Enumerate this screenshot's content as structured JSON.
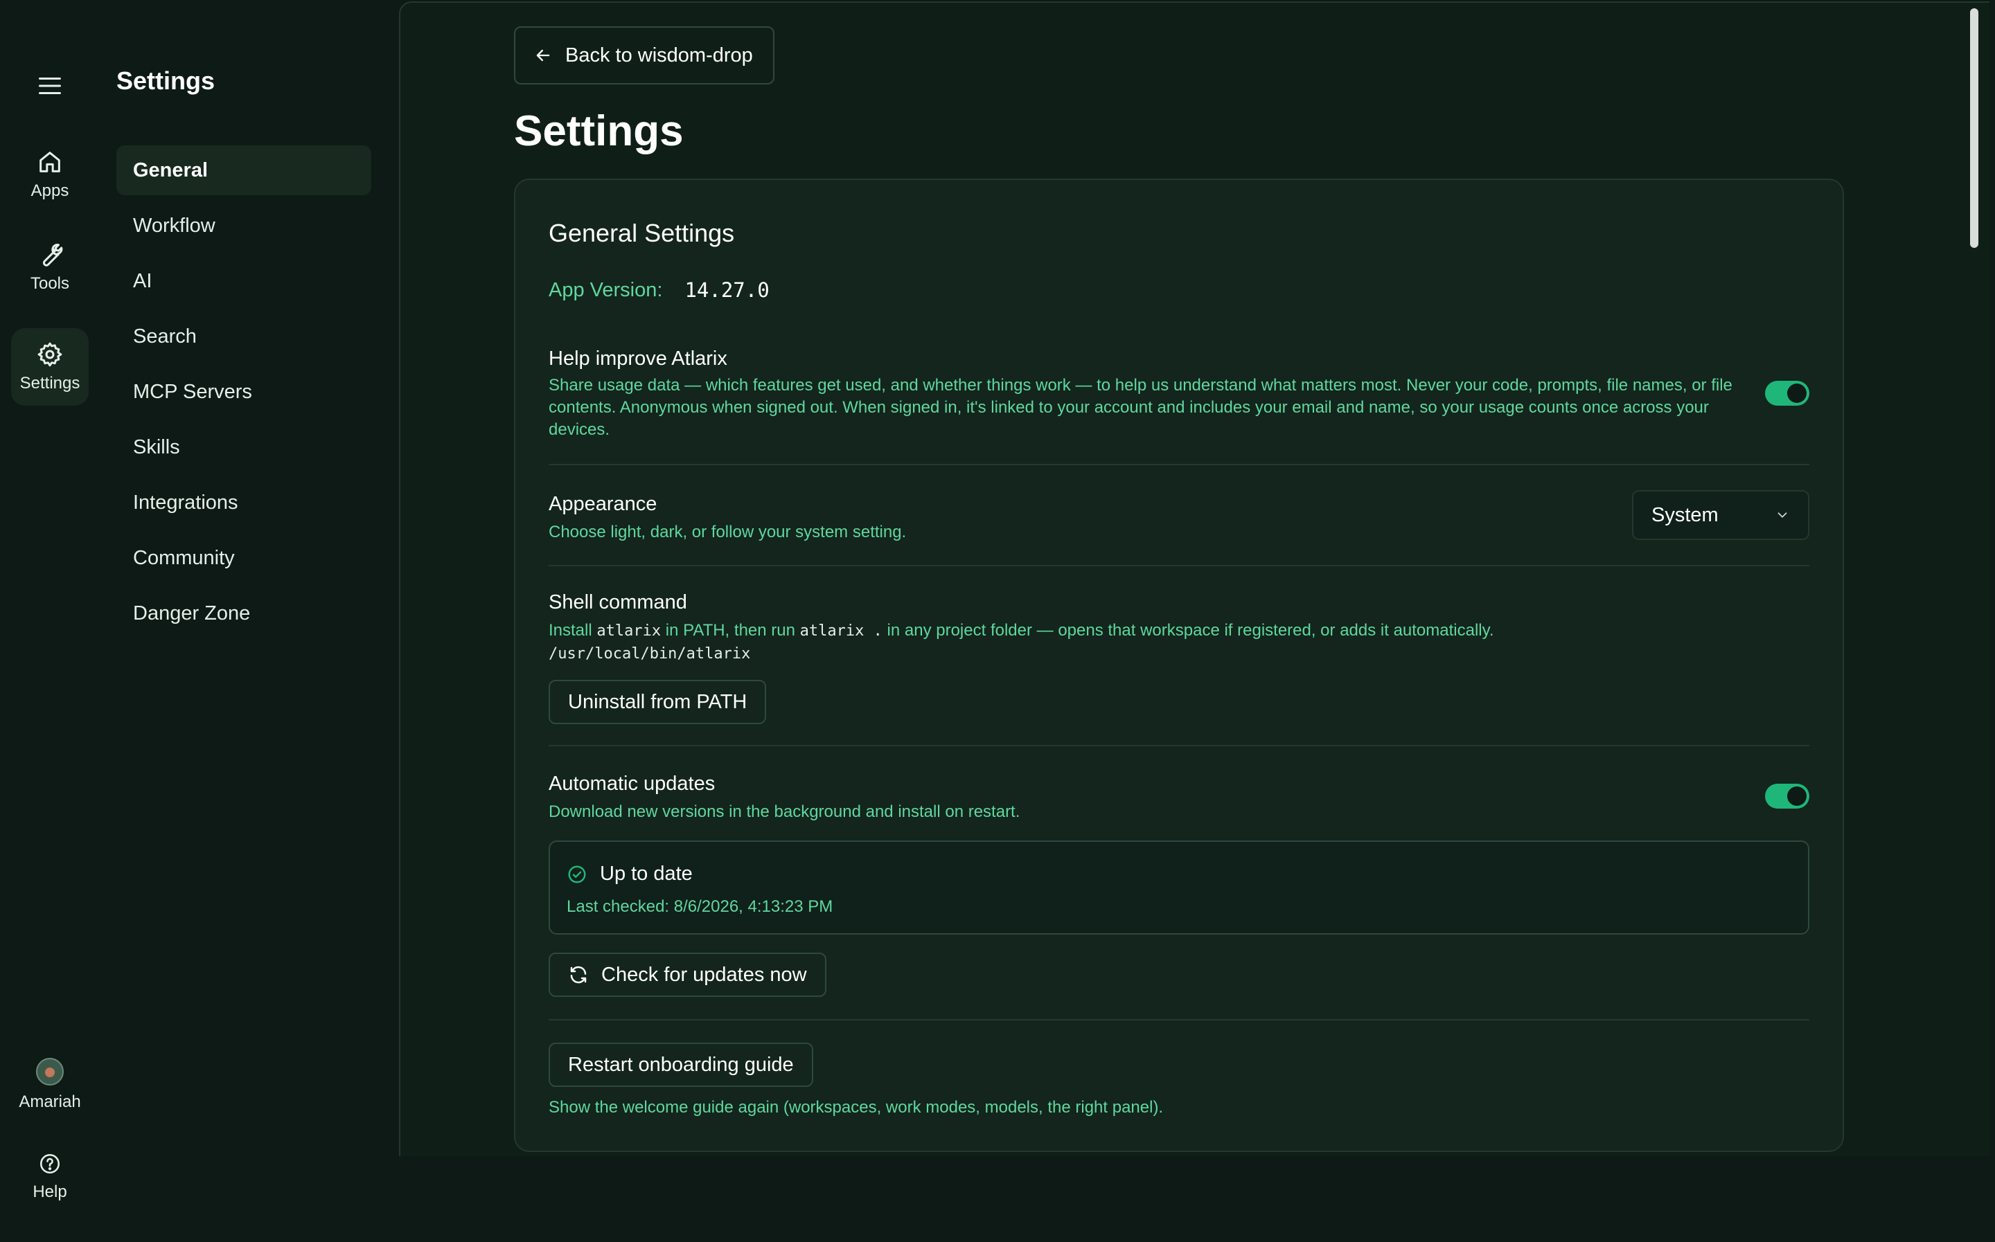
{
  "rail": {
    "items": [
      {
        "label": "Apps",
        "icon": "home-icon"
      },
      {
        "label": "Tools",
        "icon": "wrench-icon"
      },
      {
        "label": "Settings",
        "icon": "gear-icon"
      }
    ],
    "user": {
      "name": "Amariah"
    },
    "help": {
      "label": "Help"
    }
  },
  "nav": {
    "title": "Settings",
    "items": [
      "General",
      "Workflow",
      "AI",
      "Search",
      "MCP Servers",
      "Skills",
      "Integrations",
      "Community",
      "Danger Zone"
    ],
    "active": "General"
  },
  "main": {
    "back_label": "Back to wisdom-drop",
    "title": "Settings"
  },
  "general": {
    "title": "General Settings",
    "version_label": "App Version:",
    "version_value": "14.27.0",
    "telemetry": {
      "title": "Help improve Atlarix",
      "desc": "Share usage data — which features get used, and whether things work — to help us understand what matters most. Never your code, prompts, file names, or file contents. Anonymous when signed out. When signed in, it's linked to your account and includes your email and name, so your usage counts once across your devices.",
      "enabled": true
    },
    "appearance": {
      "title": "Appearance",
      "desc": "Choose light, dark, or follow your system setting.",
      "value": "System"
    },
    "shell": {
      "title": "Shell command",
      "desc_1": "Install",
      "cmd_1": "atlarix",
      "desc_2": "in PATH, then run",
      "cmd_2": "atlarix .",
      "desc_3": "in any project folder — opens that workspace if registered, or adds it automatically.",
      "path": "/usr/local/bin/atlarix",
      "button": "Uninstall from PATH"
    },
    "updates": {
      "title": "Automatic updates",
      "desc": "Download new versions in the background and install on restart.",
      "enabled": true,
      "status": "Up to date",
      "last_checked": "Last checked: 8/6/2026, 4:13:23 PM",
      "check_button": "Check for updates now"
    },
    "onboarding": {
      "button": "Restart onboarding guide",
      "desc": "Show the welcome guide again (workspaces, work modes, models, the right panel)."
    }
  },
  "colors": {
    "accent": "#1fb67a",
    "accent_text": "#5fd7a0",
    "bg": "#0d1a15",
    "card": "#13251c"
  }
}
